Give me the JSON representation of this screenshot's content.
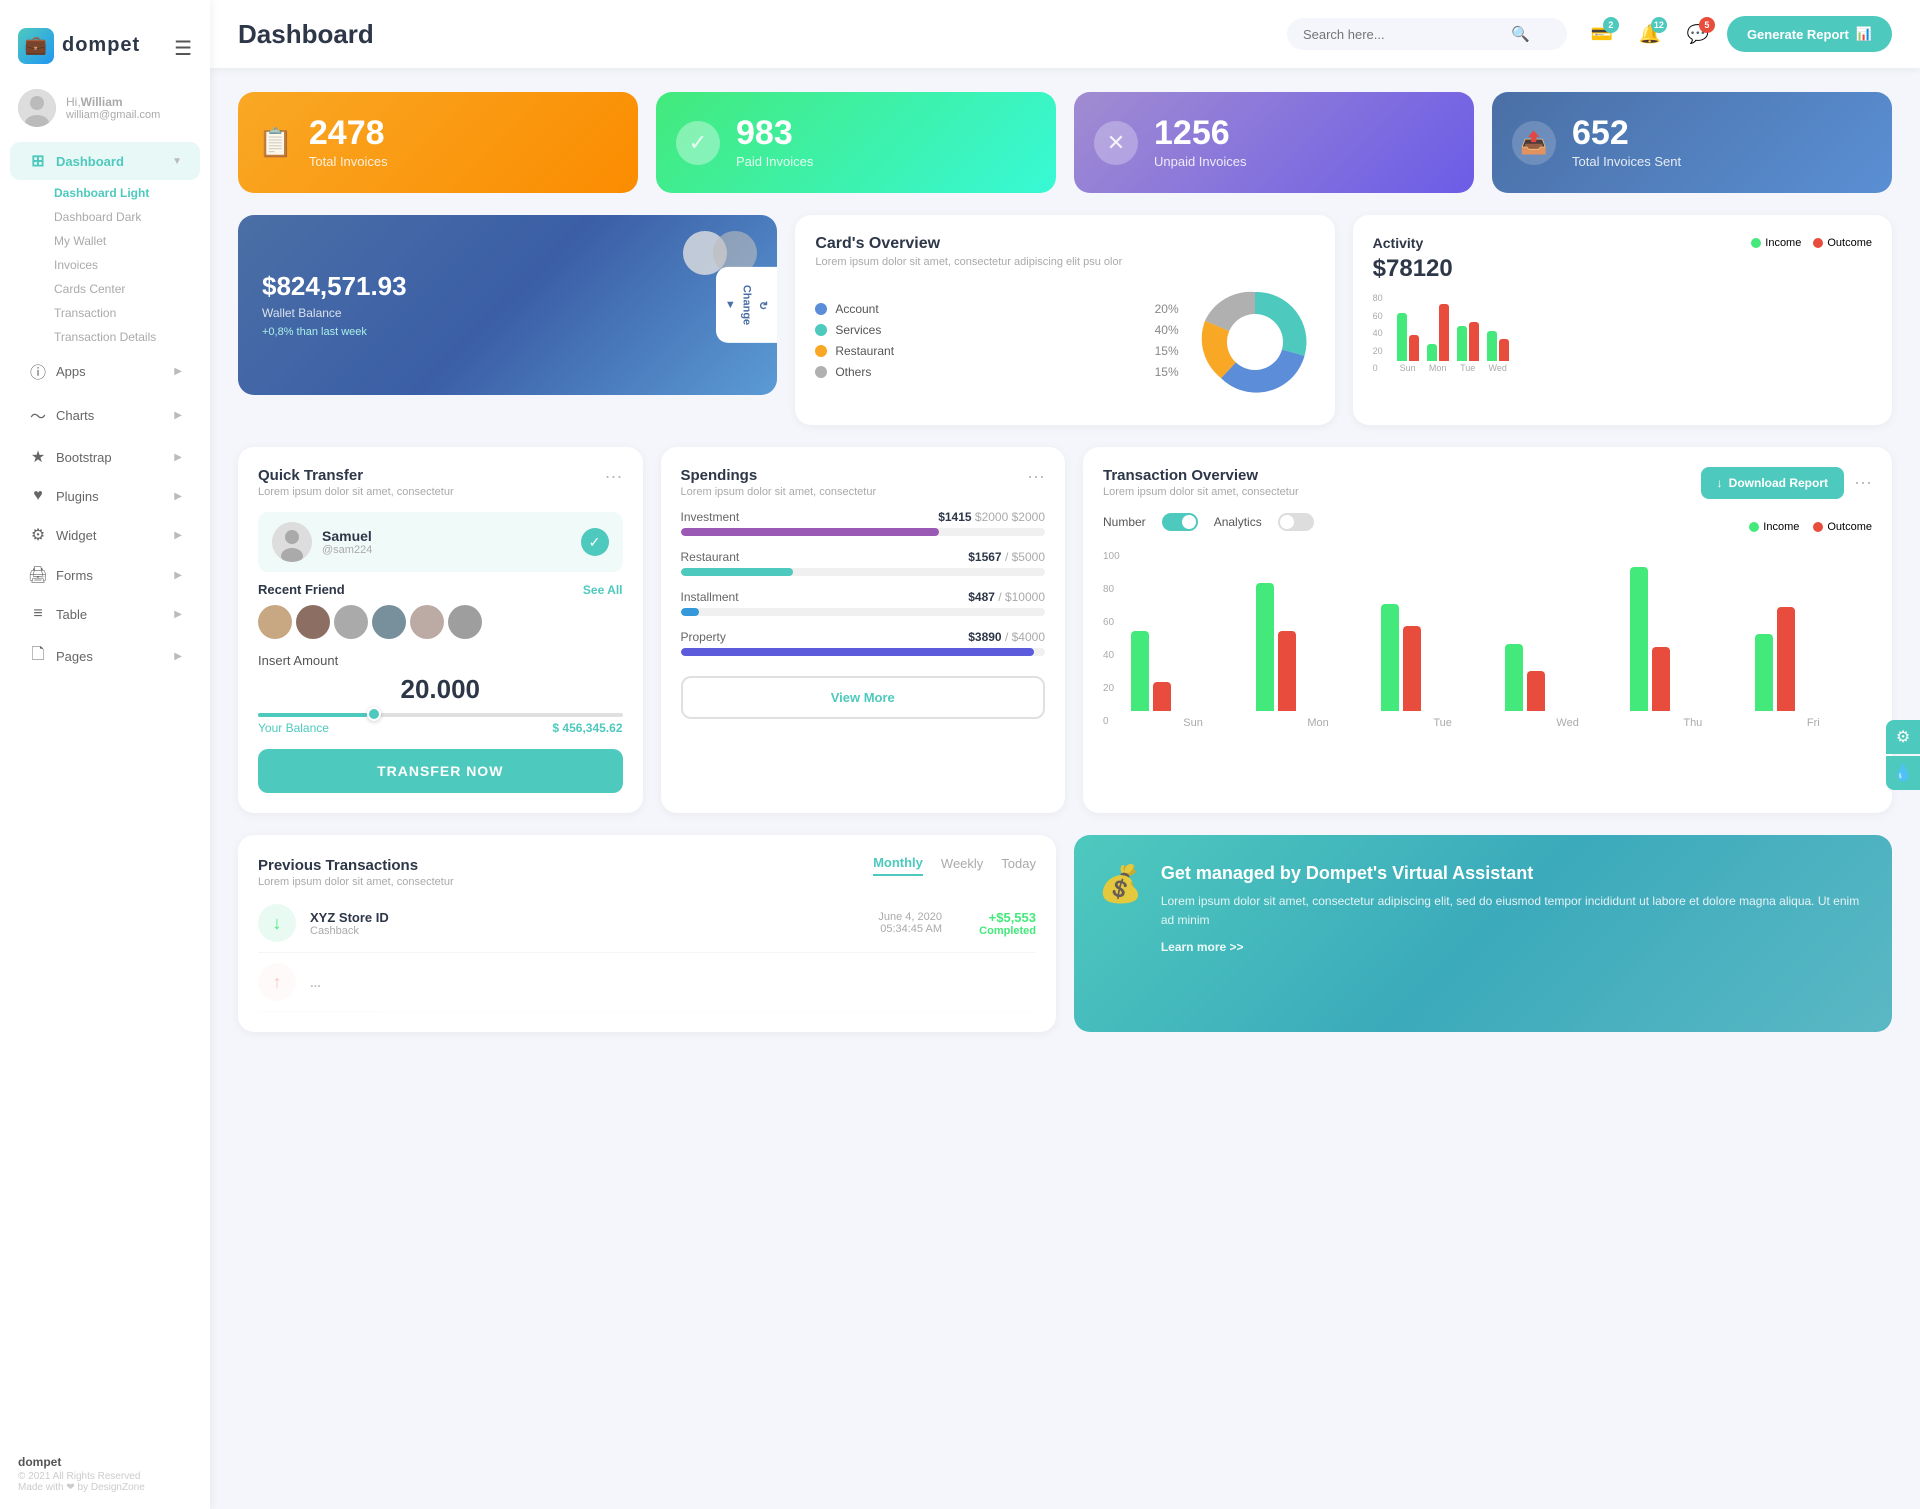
{
  "app": {
    "name": "dompet",
    "version": "© 2021 All Rights Reserved",
    "madeby": "Made with ❤ by DesignZone"
  },
  "header": {
    "title": "Dashboard",
    "search_placeholder": "Search here...",
    "generate_btn": "Generate Report",
    "icons": {
      "wallet_badge": "2",
      "bell_badge": "12",
      "chat_badge": "5"
    }
  },
  "user": {
    "hi": "Hi,",
    "name": "William",
    "email": "william@gmail.com"
  },
  "sidebar": {
    "nav": [
      {
        "id": "dashboard",
        "label": "Dashboard",
        "icon": "⊞",
        "active": true,
        "has_arrow": true
      },
      {
        "id": "apps",
        "label": "Apps",
        "icon": "ⓘ",
        "active": false,
        "has_arrow": true
      },
      {
        "id": "charts",
        "label": "Charts",
        "icon": "∿",
        "active": false,
        "has_arrow": true
      },
      {
        "id": "bootstrap",
        "label": "Bootstrap",
        "icon": "★",
        "active": false,
        "has_arrow": true
      },
      {
        "id": "plugins",
        "label": "Plugins",
        "icon": "♥",
        "active": false,
        "has_arrow": true
      },
      {
        "id": "widget",
        "label": "Widget",
        "icon": "⚙",
        "active": false,
        "has_arrow": true
      },
      {
        "id": "forms",
        "label": "Forms",
        "icon": "🖨",
        "active": false,
        "has_arrow": true
      },
      {
        "id": "table",
        "label": "Table",
        "icon": "≡",
        "active": false,
        "has_arrow": true
      },
      {
        "id": "pages",
        "label": "Pages",
        "icon": "🗋",
        "active": false,
        "has_arrow": true
      }
    ],
    "sub_items": [
      {
        "label": "Dashboard Light",
        "active": true
      },
      {
        "label": "Dashboard Dark",
        "active": false
      },
      {
        "label": "My Wallet",
        "active": false
      },
      {
        "label": "Invoices",
        "active": false
      },
      {
        "label": "Cards Center",
        "active": false
      },
      {
        "label": "Transaction",
        "active": false
      },
      {
        "label": "Transaction Details",
        "active": false
      }
    ]
  },
  "stat_cards": [
    {
      "id": "total",
      "number": "2478",
      "label": "Total Invoices",
      "icon": "📋",
      "color": "orange"
    },
    {
      "id": "paid",
      "number": "983",
      "label": "Paid Invoices",
      "icon": "✓",
      "color": "green"
    },
    {
      "id": "unpaid",
      "number": "1256",
      "label": "Unpaid Invoices",
      "icon": "✕",
      "color": "purple"
    },
    {
      "id": "sent",
      "number": "652",
      "label": "Total Invoices Sent",
      "icon": "📤",
      "color": "blue-gray"
    }
  ],
  "wallet": {
    "amount": "$824,571.93",
    "label": "Wallet Balance",
    "change": "+0,8% than last week",
    "change_btn": "Change"
  },
  "cards_overview": {
    "title": "Card's Overview",
    "desc": "Lorem ipsum dolor sit amet, consectetur adipiscing elit psu olor",
    "legend": [
      {
        "label": "Account",
        "color": "#5b8dd9",
        "pct": "20%"
      },
      {
        "label": "Services",
        "color": "#4ec9be",
        "pct": "40%"
      },
      {
        "label": "Restaurant",
        "color": "#f9a825",
        "pct": "15%"
      },
      {
        "label": "Others",
        "color": "#b0b0b0",
        "pct": "15%"
      }
    ]
  },
  "activity": {
    "title": "Activity",
    "amount": "$78120",
    "legend_income": "Income",
    "legend_outcome": "Outcome",
    "bars": [
      {
        "day": "Sun",
        "income": 55,
        "outcome": 30
      },
      {
        "day": "Mon",
        "income": 20,
        "outcome": 65
      },
      {
        "day": "Tue",
        "income": 40,
        "outcome": 45
      },
      {
        "day": "Wed",
        "income": 35,
        "outcome": 25
      }
    ]
  },
  "quick_transfer": {
    "title": "Quick Transfer",
    "desc": "Lorem ipsum dolor sit amet, consectetur",
    "user": {
      "name": "Samuel",
      "handle": "@sam224"
    },
    "recent_friend_label": "Recent Friend",
    "see_all": "See All",
    "insert_amount_label": "Insert Amount",
    "amount": "20.000",
    "balance_label": "Your Balance",
    "balance": "$ 456,345.62",
    "transfer_btn": "TRANSFER NOW"
  },
  "spendings": {
    "title": "Spendings",
    "desc": "Lorem ipsum dolor sit amet, consectetur",
    "items": [
      {
        "label": "Investment",
        "amount": "$1415",
        "limit": "$2000",
        "pct": 71,
        "color": "#9b59b6"
      },
      {
        "label": "Restaurant",
        "amount": "$1567",
        "limit": "$5000",
        "pct": 31,
        "color": "#4ec9be"
      },
      {
        "label": "Installment",
        "amount": "$487",
        "limit": "$10000",
        "pct": 5,
        "color": "#3498db"
      },
      {
        "label": "Property",
        "amount": "$3890",
        "limit": "$4000",
        "pct": 97,
        "color": "#5b5bdb"
      }
    ],
    "view_more_btn": "View More"
  },
  "transaction_overview": {
    "title": "Transaction Overview",
    "desc": "Lorem ipsum dolor sit amet, consectetur",
    "toggle_number": "Number",
    "toggle_analytics": "Analytics",
    "download_btn": "Download Report",
    "legend_income": "Income",
    "legend_outcome": "Outcome",
    "bars": [
      {
        "day": "Sun",
        "income": 50,
        "outcome": 18
      },
      {
        "day": "Mon",
        "income": 80,
        "outcome": 50
      },
      {
        "day": "Tue",
        "income": 67,
        "outcome": 53
      },
      {
        "day": "Wed",
        "income": 42,
        "outcome": 25
      },
      {
        "day": "Thu",
        "income": 90,
        "outcome": 40
      },
      {
        "day": "Fri",
        "income": 48,
        "outcome": 65
      }
    ]
  },
  "prev_transactions": {
    "title": "Previous Transactions",
    "desc": "Lorem ipsum dolor sit amet, consectetur",
    "tabs": [
      "Monthly",
      "Weekly",
      "Today"
    ],
    "active_tab": "Monthly",
    "items": [
      {
        "icon": "↓",
        "icon_type": "green",
        "name": "XYZ Store ID",
        "type": "Cashback",
        "date": "June 4, 2020",
        "time": "05:34:45 AM",
        "amount": "+$5,553",
        "status": "Completed"
      }
    ]
  },
  "promo": {
    "title": "Get managed by Dompet's Virtual Assistant",
    "desc": "Lorem ipsum dolor sit amet, consectetur adipiscing elit, sed do eiusmod tempor incididunt ut labore et dolore magna aliqua. Ut enim ad minim",
    "link": "Learn more >>"
  }
}
